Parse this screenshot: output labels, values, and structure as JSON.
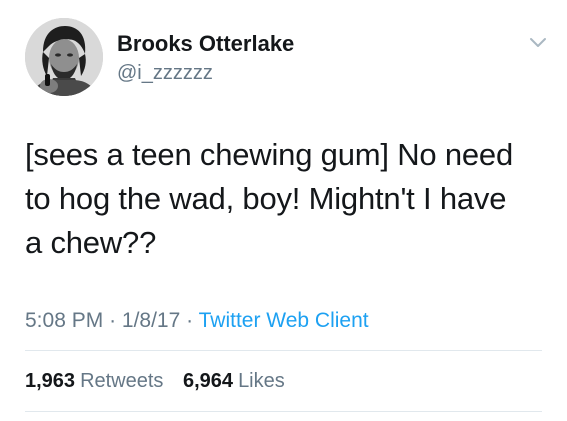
{
  "author": {
    "display_name": "Brooks Otterlake",
    "handle": "@i_zzzzzz"
  },
  "tweet": {
    "text_lines": [
      "[sees a teen chewing gum] No need",
      "to hog the wad, boy! Mightn't I have",
      "a chew??"
    ]
  },
  "meta": {
    "time": "5:08 PM",
    "separator": "·",
    "date": "1/8/17",
    "client": "Twitter Web Client"
  },
  "stats": {
    "retweets_count": "1,963",
    "retweets_label": "Retweets",
    "likes_count": "6,964",
    "likes_label": "Likes"
  },
  "icons": {
    "menu": "chevron-down-icon",
    "avatar": "avatar"
  },
  "colors": {
    "text": "#14171a",
    "secondary": "#657786",
    "link": "#1da1f2",
    "divider": "#e1e8ed"
  }
}
